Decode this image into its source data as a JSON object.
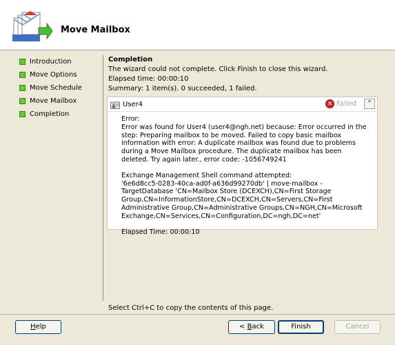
{
  "header": {
    "title": "Move Mailbox"
  },
  "nav": {
    "items": [
      {
        "label": "Introduction"
      },
      {
        "label": "Move Options"
      },
      {
        "label": "Move Schedule"
      },
      {
        "label": "Move Mailbox"
      },
      {
        "label": "Completion"
      }
    ]
  },
  "content": {
    "title": "Completion",
    "message": "The wizard could not complete. Click Finish to close this wizard.",
    "elapsed": "Elapsed time: 00:00:10",
    "summary": "Summary: 1 item(s). 0 succeeded, 1 failed."
  },
  "result": {
    "user": "User4",
    "status": "Failed",
    "error_label": "Error:",
    "error_text": "Error was found for User4 (user4@ngh.net) because: Error occurred in the step: Preparing mailbox to be moved. Failed to copy basic mailbox information with error: A duplicate mailbox was found due to problems during a Move Mailbox procedure. The duplicate mailbox has been deleted. Try again later., error code: -1056749241",
    "command_label": "Exchange Management Shell command attempted:",
    "command_text": "'6e6d8cc5-0283-40ca-ad0f-a636d99270db' | move-mailbox -TargetDatabase 'CN=Mailbox Store (DCEXCH),CN=First Storage Group,CN=InformationStore,CN=DCEXCH,CN=Servers,CN=First Administrative Group,CN=Administrative Groups,CN=NGH,CN=Microsoft Exchange,CN=Services,CN=Configuration,DC=ngh,DC=net'",
    "elapsed_time": "Elapsed Time: 00:00:10"
  },
  "footer": {
    "hint": "Select Ctrl+C to copy the contents of this page.",
    "help": {
      "mnemonic": "H",
      "rest": "elp"
    },
    "back": {
      "prefix": "< ",
      "mnemonic": "B",
      "rest": "ack"
    },
    "finish": "Finish",
    "cancel": "Cancel"
  },
  "colors": {
    "window_bg": "#ece9d8",
    "nav_check": "#66cc33",
    "failed_icon": "#cc2a1e"
  }
}
